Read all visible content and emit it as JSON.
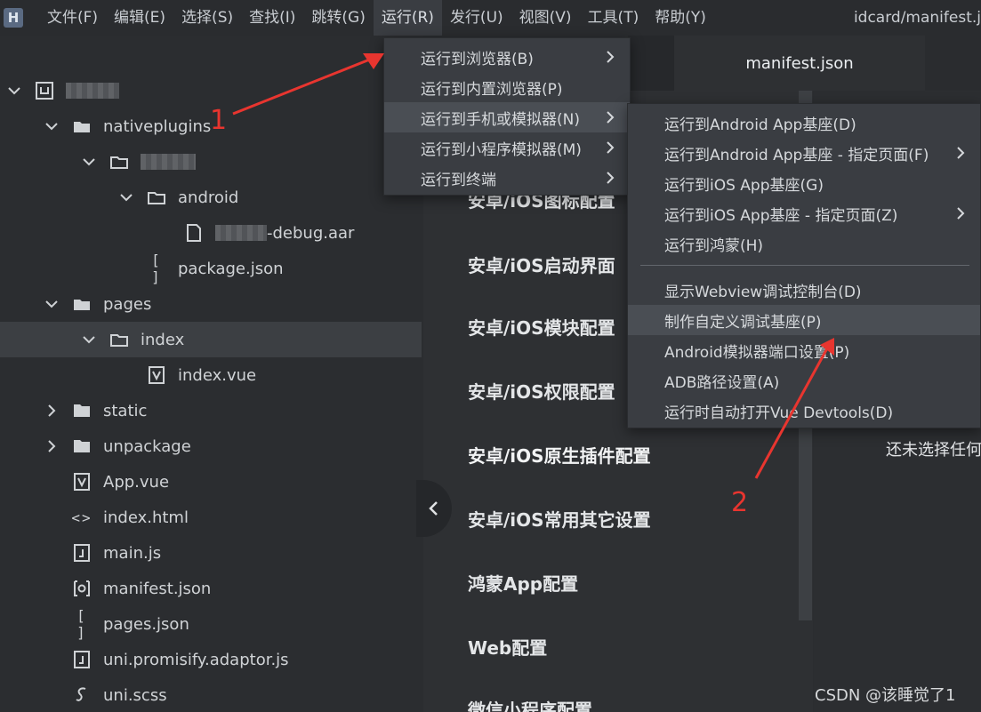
{
  "menubar": {
    "logo": "H",
    "items": [
      "文件(F)",
      "编辑(E)",
      "选择(S)",
      "查找(I)",
      "跳转(G)",
      "运行(R)",
      "发行(U)",
      "视图(V)",
      "工具(T)",
      "帮助(Y)"
    ],
    "window_title": "idcard/manifest.j"
  },
  "tree": {
    "nativeplugins": "nativeplugins",
    "android": "android",
    "aar_suffix": "-debug.aar",
    "package_json": "package.json",
    "pages": "pages",
    "index": "index",
    "index_vue": "index.vue",
    "static": "static",
    "unpackage": "unpackage",
    "app_vue": "App.vue",
    "index_html": "index.html",
    "main_js": "main.js",
    "manifest_json": "manifest.json",
    "pages_json": "pages.json",
    "promisify": "uni.promisify.adaptor.js",
    "uni_scss": "uni.scss"
  },
  "editor": {
    "tab_label": "manifest.json",
    "settings": [
      "安卓/iOS图标配置",
      "安卓/iOS启动界面",
      "安卓/iOS模块配置",
      "安卓/iOS权限配置",
      "安卓/iOS原生插件配置",
      "安卓/iOS常用其它设置",
      "鸿蒙App配置",
      "Web配置",
      "微信小程序配置"
    ],
    "empty_text": "还未选择任何"
  },
  "run_menu": [
    "运行到浏览器(B)",
    "运行到内置浏览器(P)",
    "运行到手机或模拟器(N)",
    "运行到小程序模拟器(M)",
    "运行到终端"
  ],
  "device_submenu": [
    "运行到Android App基座(D)",
    "运行到Android App基座 - 指定页面(F)",
    "运行到iOS App基座(G)",
    "运行到iOS App基座 - 指定页面(Z)",
    "运行到鸿蒙(H)",
    "显示Webview调试控制台(D)",
    "制作自定义调试基座(P)",
    "Android模拟器端口设置(P)",
    "ADB路径设置(A)",
    "运行时自动打开Vue Devtools(D)"
  ],
  "annotations": [
    "1",
    "2"
  ],
  "watermark": "CSDN @该睡觉了1",
  "colors": {
    "annotation_red": "#e8352f",
    "menu_bg": "#3a3d42",
    "hover_bg": "#4a4e54"
  }
}
